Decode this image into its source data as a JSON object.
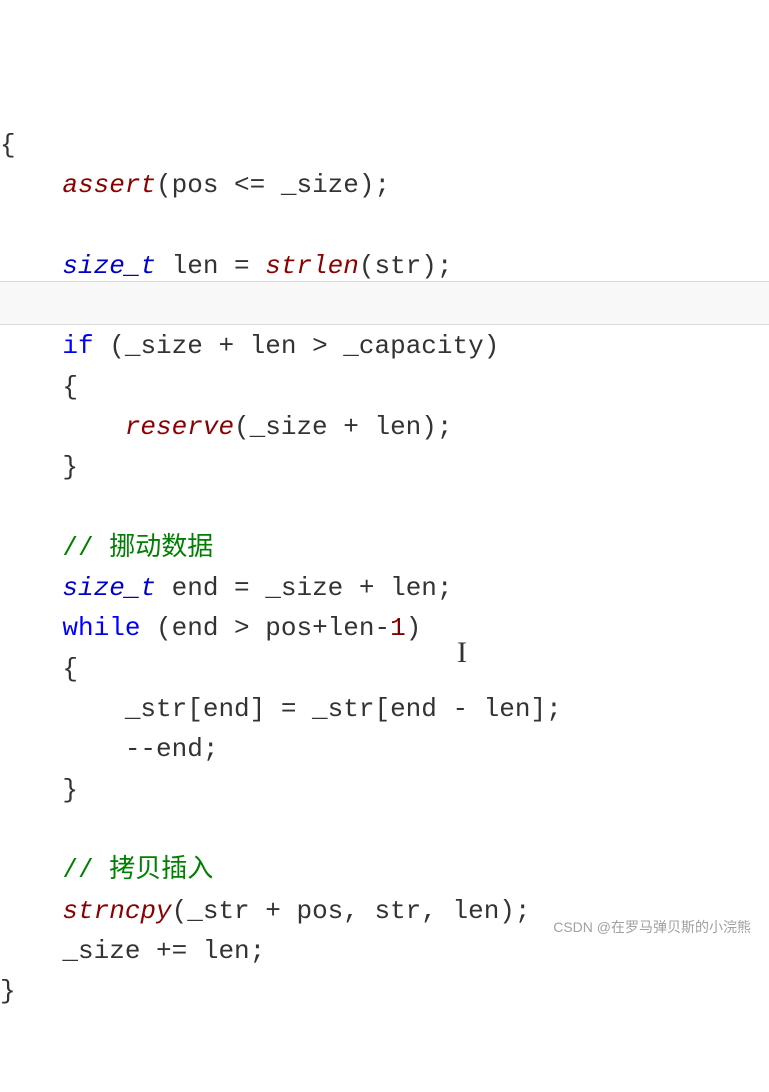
{
  "code": {
    "l1": "{",
    "l2_func": "assert",
    "l2_rest": "(pos <= _size);",
    "l4_type": "size_t",
    "l4_var": " len = ",
    "l4_func": "strlen",
    "l4_rest": "(str);",
    "l6_kw": "if",
    "l6_rest": " (_size + len > _capacity)",
    "l7": "{",
    "l8_func": "reserve",
    "l8_rest": "(_size + len);",
    "l9": "}",
    "l11_comment": "// 挪动数据",
    "l12_type": "size_t",
    "l12_rest": " end = _size + len;",
    "l13_kw": "while",
    "l13_rest": " (end > pos+len-",
    "l13_num": "1",
    "l13_end": ")",
    "l14": "{",
    "l15": "_str[end] = _str[end - len];",
    "l16": "--end;",
    "l17": "}",
    "l19_comment": "// 拷贝插入",
    "l20_func": "strncpy",
    "l20_rest": "(_str + pos, str, len);",
    "l21": "_size += len;",
    "l22": "}"
  },
  "watermark": "CSDN @在罗马弹贝斯的小浣熊"
}
